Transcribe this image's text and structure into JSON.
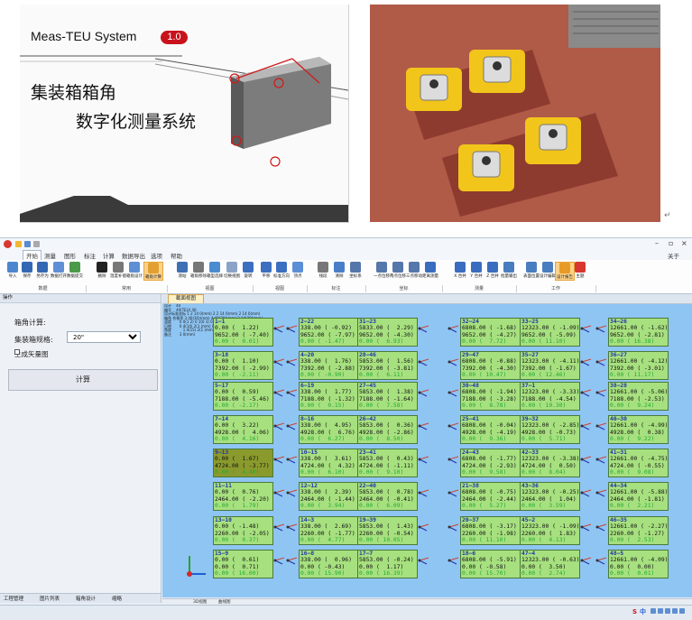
{
  "banner": {
    "system_name": "Meas-TEU System",
    "version": "1.0",
    "title_line1": "集装箱箱角",
    "title_line2": "数字化测量系统"
  },
  "app": {
    "menu": [
      "开始",
      "测量",
      "图形",
      "标注",
      "计算",
      "数据导出",
      "选项",
      "帮助"
    ],
    "active_menu": "开始",
    "right_menu": "关于",
    "ribbon_buttons": [
      "导入",
      "保存",
      "另存为",
      "数据打开",
      "数据提交",
      "删除",
      "温度补偿",
      "箱角设计",
      "箱角计算",
      "测站",
      "箱角移除",
      "箱型选择",
      "切换视图",
      "旋转",
      "平移",
      "标准方向",
      "顶点",
      "线段",
      "清除",
      "坐标系",
      "一点位移",
      "两点位移",
      "三点移动",
      "距离测量",
      "X 合并",
      "Y 合并",
      "Z 合并",
      "批量输出",
      "表面位置",
      "设计编辑",
      "设计报告",
      "主题"
    ],
    "ribbon_groups": [
      "数据",
      "常用",
      "视图",
      "视图",
      "标注",
      "坐标",
      "测量",
      "工作"
    ],
    "panel": {
      "title": "操作",
      "section": "箱角计算:",
      "spec_label": "集装箱规格:",
      "spec_value": "20\"",
      "vector_checkbox": "生成矢量图",
      "calc_button": "计算",
      "bottom_tabs": [
        "工程管理",
        "图片列表",
        "箱角设计",
        "缩略"
      ]
    },
    "doc_tab": "截面视图",
    "info_lines": [
      "设计    40",
      "编号    40(TEU) 40",
      "设计标准坐标 1 2 14 0(mm) 2 2 14 0(mm) 2 14 0(mm)",
      "箱角 合格率 3 40(30)(mm) 4 40(30)(mm) 3 14(30)(mm)",
      "温度       0 0(1 2) 0 1(0 3) 0 1(0 3)",
      "日期       0 4(14) 2(1 (mm) 0 40 (mm)",
      "角度          1 4(15) 2(1 (mm) 0 40 (mm)",
      "备注       3 0(mm)"
    ],
    "boxes": [
      {
        "name": "1—1",
        "x": "0.00 (  1.22)",
        "y": "9652.00 ( -7.40)",
        "z": "0.00 (  0.01)"
      },
      {
        "name": "2—22",
        "x": "338.00 ( -0.92)",
        "y": "9652.00 ( -7.97)",
        "z": "0.00 ( -1.47)"
      },
      {
        "name": "31—23",
        "x": "5833.00 (  2.29)",
        "y": "9652.00 ( -4.30)",
        "z": "0.00 (  6.93)"
      },
      {
        "name": "32—24",
        "x": "6808.00 ( -1.68)",
        "y": "9652.00 ( -4.27)",
        "z": "0.00 (  7.72)"
      },
      {
        "name": "33—25",
        "x": "12323.00 ( -1.09)",
        "y": "9652.00 ( -5.09)",
        "z": "0.00 ( 11.10)"
      },
      {
        "name": "34—26",
        "x": "12661.00 ( -1.62)",
        "y": "9652.00 ( -2.81)",
        "z": "0.00 ( 16.38)"
      },
      {
        "name": "3—18",
        "x": "0.00 (  1.10)",
        "y": "7392.00 ( -2.99)",
        "z": "0.00 ( -2.11)"
      },
      {
        "name": "4—20",
        "x": "338.00 (  1.76)",
        "y": "7392.00 ( -2.88)",
        "z": "0.00 ( -0.90)"
      },
      {
        "name": "28—46",
        "x": "5853.00 (  1.56)",
        "y": "7392.00 ( -3.81)",
        "z": "0.00 (  6.11)"
      },
      {
        "name": "29—47",
        "x": "6808.00 ( -0.88)",
        "y": "7392.00 ( -4.30)",
        "z": "0.00 ( 10.47)"
      },
      {
        "name": "35—27",
        "x": "12323.00 ( -4.11)",
        "y": "7392.00 ( -1.67)",
        "z": "0.00 ( 12.46)"
      },
      {
        "name": "36—27",
        "x": "12661.00 ( -4.12)",
        "y": "7392.00 ( -3.01)",
        "z": "0.00 ( 11.17)"
      },
      {
        "name": "5—17",
        "x": "0.00 (  0.59)",
        "y": "7188.00 ( -5.46)",
        "z": "0.00 ( -2.17)"
      },
      {
        "name": "6—19",
        "x": "338.00 (  1.77)",
        "y": "7188.00 ( -1.32)",
        "z": "0.00 (  0.15)"
      },
      {
        "name": "27—45",
        "x": "5853.00 (  1.38)",
        "y": "7188.00 ( -1.64)",
        "z": "0.00 (  7.58)"
      },
      {
        "name": "30—48",
        "x": "6808.00 ( -1.94)",
        "y": "7188.00 ( -3.28)",
        "z": "0.00 (  8.78)"
      },
      {
        "name": "37—1",
        "x": "12323.00 ( -3.33)",
        "y": "7188.00 ( -4.54)",
        "z": "0.00 ( 10.30)"
      },
      {
        "name": "38—28",
        "x": "12661.00 ( -5.06)",
        "y": "7188.00 ( -2.53)",
        "z": "0.00 (  9.24)"
      },
      {
        "name": "7—14",
        "x": "0.00 (  3.22)",
        "y": "4928.00 (  4.06)",
        "z": "0.00 (  4.16)"
      },
      {
        "name": "8—16",
        "x": "338.00 (  4.95)",
        "y": "4928.00 (  6.76)",
        "z": "0.00 (  6.27)"
      },
      {
        "name": "26—42",
        "x": "5853.00 (  0.36)",
        "y": "4928.00 ( -2.86)",
        "z": "0.00 (  8.50)"
      },
      {
        "name": "25—41",
        "x": "6808.00 ( -0.04)",
        "y": "4928.00 ( -4.19)",
        "z": "0.00 (  9.36)"
      },
      {
        "name": "39—32",
        "x": "12323.00 ( -2.85)",
        "y": "4928.00 ( -0.73)",
        "z": "0.00 (  5.71)"
      },
      {
        "name": "40—30",
        "x": "12661.00 ( -4.99)",
        "y": "4928.00 (  0.38)",
        "z": "0.00 (  9.22)"
      },
      {
        "name": "9—13",
        "x": "0.00 (  1.67)",
        "y": "4724.00 ( -3.77)",
        "z": "0.00 (  4.40)"
      },
      {
        "name": "10—15",
        "x": "338.00 (  3.61)",
        "y": "4724.00 (  4.32)",
        "z": "0.00 (  6.10)"
      },
      {
        "name": "23—41",
        "x": "5853.00 (  0.43)",
        "y": "4724.00 ( -1.11)",
        "z": "0.00 (  9.10)"
      },
      {
        "name": "24—43",
        "x": "6808.00 ( -1.77)",
        "y": "4724.00 ( -2.93)",
        "z": "0.00 (  9.58)"
      },
      {
        "name": "42—33",
        "x": "12323.00 ( -3.38)",
        "y": "4724.00 (  0.50)",
        "z": "0.00 (  8.04)"
      },
      {
        "name": "41—31",
        "x": "12661.00 ( -4.75)",
        "y": "4724.00 ( -0.55)",
        "z": "0.00 (  9.08)"
      },
      {
        "name": "11—11",
        "x": "0.00 (  0.76)",
        "y": "2464.00 ( -2.20)",
        "z": "0.00 (  1.79)"
      },
      {
        "name": "12—12",
        "x": "338.00 (  2.39)",
        "y": "2464.00 ( -1.44)",
        "z": "0.00 (  3.94)"
      },
      {
        "name": "22—40",
        "x": "5853.00 (  0.78)",
        "y": "2464.00 ( -0.41)",
        "z": "0.00 (  6.09)"
      },
      {
        "name": "21—38",
        "x": "6808.00 ( -0.75)",
        "y": "2464.00 ( -2.44)",
        "z": "0.00 (  5.27)"
      },
      {
        "name": "43—36",
        "x": "12323.00 ( -0.25)",
        "y": "2464.00 (  1.04)",
        "z": "0.00 (  3.59)"
      },
      {
        "name": "44—34",
        "x": "12661.00 ( -5.88)",
        "y": "2464.00 ( -1.81)",
        "z": "0.00 (  2.21)"
      },
      {
        "name": "13—10",
        "x": "0.00 ( -1.48)",
        "y": "2260.00 ( -2.05)",
        "z": "0.00 (  0.37)"
      },
      {
        "name": "14—3",
        "x": "338.00 (  2.69)",
        "y": "2260.00 ( -1.77)",
        "z": "0.00 (  4.77)"
      },
      {
        "name": "19—39",
        "x": "5853.00 (  1.43)",
        "y": "2260.00 ( -0.54)",
        "z": "0.00 ( 10.05)"
      },
      {
        "name": "20—37",
        "x": "6808.00 ( -3.17)",
        "y": "2260.00 ( -1.98)",
        "z": "0.00 ( 11.10)"
      },
      {
        "name": "45—2",
        "x": "12323.00 ( -1.09)",
        "y": "2260.00 (  1.83)",
        "z": "0.00 (  4.13)"
      },
      {
        "name": "46—35",
        "x": "12661.00 ( -2.27)",
        "y": "2260.00 ( -1.27)",
        "z": "0.00 (  2.53)"
      },
      {
        "name": "15—9",
        "x": "0.00 (  0.61)",
        "y": "0.00 (  0.71)",
        "z": "0.00 ( 16.00)"
      },
      {
        "name": "16—8",
        "x": "338.00 (  0.96)",
        "y": "0.00 ( -0.43)",
        "z": "0.00 ( 15.90)"
      },
      {
        "name": "17—7",
        "x": "5853.00 ( -0.24)",
        "y": "0.00 (  1.17)",
        "z": "0.00 ( 16.39)"
      },
      {
        "name": "18—6",
        "x": "6808.00 ( -5.91)",
        "y": "0.00 ( -0.58)",
        "z": "0.00 ( 15.70)"
      },
      {
        "name": "47—4",
        "x": "12323.00 ( -0.63)",
        "y": "0.00 (  3.50)",
        "z": "0.00 (  2.74)"
      },
      {
        "name": "48—5",
        "x": "12661.00 ( -4.09)",
        "y": "0.00 (  0.00)",
        "z": "0.00 (  0.01)"
      }
    ],
    "bottom_tabs": [
      "3D视图",
      "曲线图"
    ],
    "status_logo": "S",
    "status_lang": "中"
  },
  "colors": {
    "canvas_bg": "#8fc5f3",
    "box_bg": "#a7e07f",
    "box_selected": "#8a9a2d",
    "brand_red": "#c8131d"
  }
}
